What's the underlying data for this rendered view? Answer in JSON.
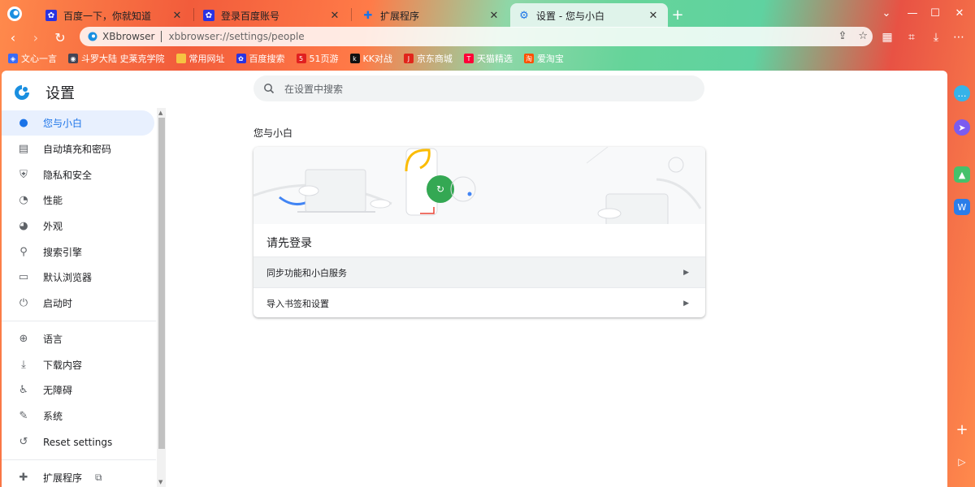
{
  "tabs": [
    {
      "title": "百度一下，你就知道",
      "favicon": "baidu-paw-icon"
    },
    {
      "title": "登录百度账号",
      "favicon": "baidu-paw-icon"
    },
    {
      "title": "扩展程序",
      "favicon": "puzzle-icon"
    },
    {
      "title": "设置 - 您与小白",
      "favicon": "gear-icon",
      "active": true
    }
  ],
  "toolbar": {
    "site_name": "XBbrowser",
    "url": "xbbrowser://settings/people"
  },
  "bookmarks": [
    {
      "label": "文心一言",
      "icon": "wenxin-icon"
    },
    {
      "label": "斗罗大陆 史莱克学院",
      "icon": "game-icon"
    },
    {
      "label": "常用网址",
      "icon": "folder-icon"
    },
    {
      "label": "百度搜索",
      "icon": "baidu-paw-icon"
    },
    {
      "label": "51页游",
      "icon": "game51-icon"
    },
    {
      "label": "KK对战",
      "icon": "kk-icon"
    },
    {
      "label": "京东商城",
      "icon": "jd-icon"
    },
    {
      "label": "天猫精选",
      "icon": "tmall-icon"
    },
    {
      "label": "爱淘宝",
      "icon": "taobao-icon"
    }
  ],
  "settings": {
    "title": "设置",
    "search_placeholder": "在设置中搜索",
    "section_title": "您与小白",
    "signin_title": "请先登录",
    "rows": [
      "同步功能和小白服务",
      "导入书签和设置"
    ]
  },
  "sidebar": {
    "items": [
      {
        "label": "您与小白",
        "icon": "person-icon",
        "active": true
      },
      {
        "label": "自动填充和密码",
        "icon": "clipboard-icon"
      },
      {
        "label": "隐私和安全",
        "icon": "shield-icon"
      },
      {
        "label": "性能",
        "icon": "speedometer-icon"
      },
      {
        "label": "外观",
        "icon": "palette-icon"
      },
      {
        "label": "搜索引擎",
        "icon": "search-icon"
      },
      {
        "label": "默认浏览器",
        "icon": "browser-icon"
      },
      {
        "label": "启动时",
        "icon": "power-icon"
      },
      {
        "label": "语言",
        "icon": "globe-icon"
      },
      {
        "label": "下载内容",
        "icon": "download-icon"
      },
      {
        "label": "无障碍",
        "icon": "accessibility-icon"
      },
      {
        "label": "系统",
        "icon": "wrench-icon"
      },
      {
        "label": "Reset settings",
        "icon": "reset-icon"
      },
      {
        "label": "扩展程序",
        "icon": "puzzle-icon"
      }
    ]
  },
  "colors": {
    "accent": "#1a73e8",
    "active_bg": "#e8f0fe",
    "sync_green": "#34a853"
  }
}
